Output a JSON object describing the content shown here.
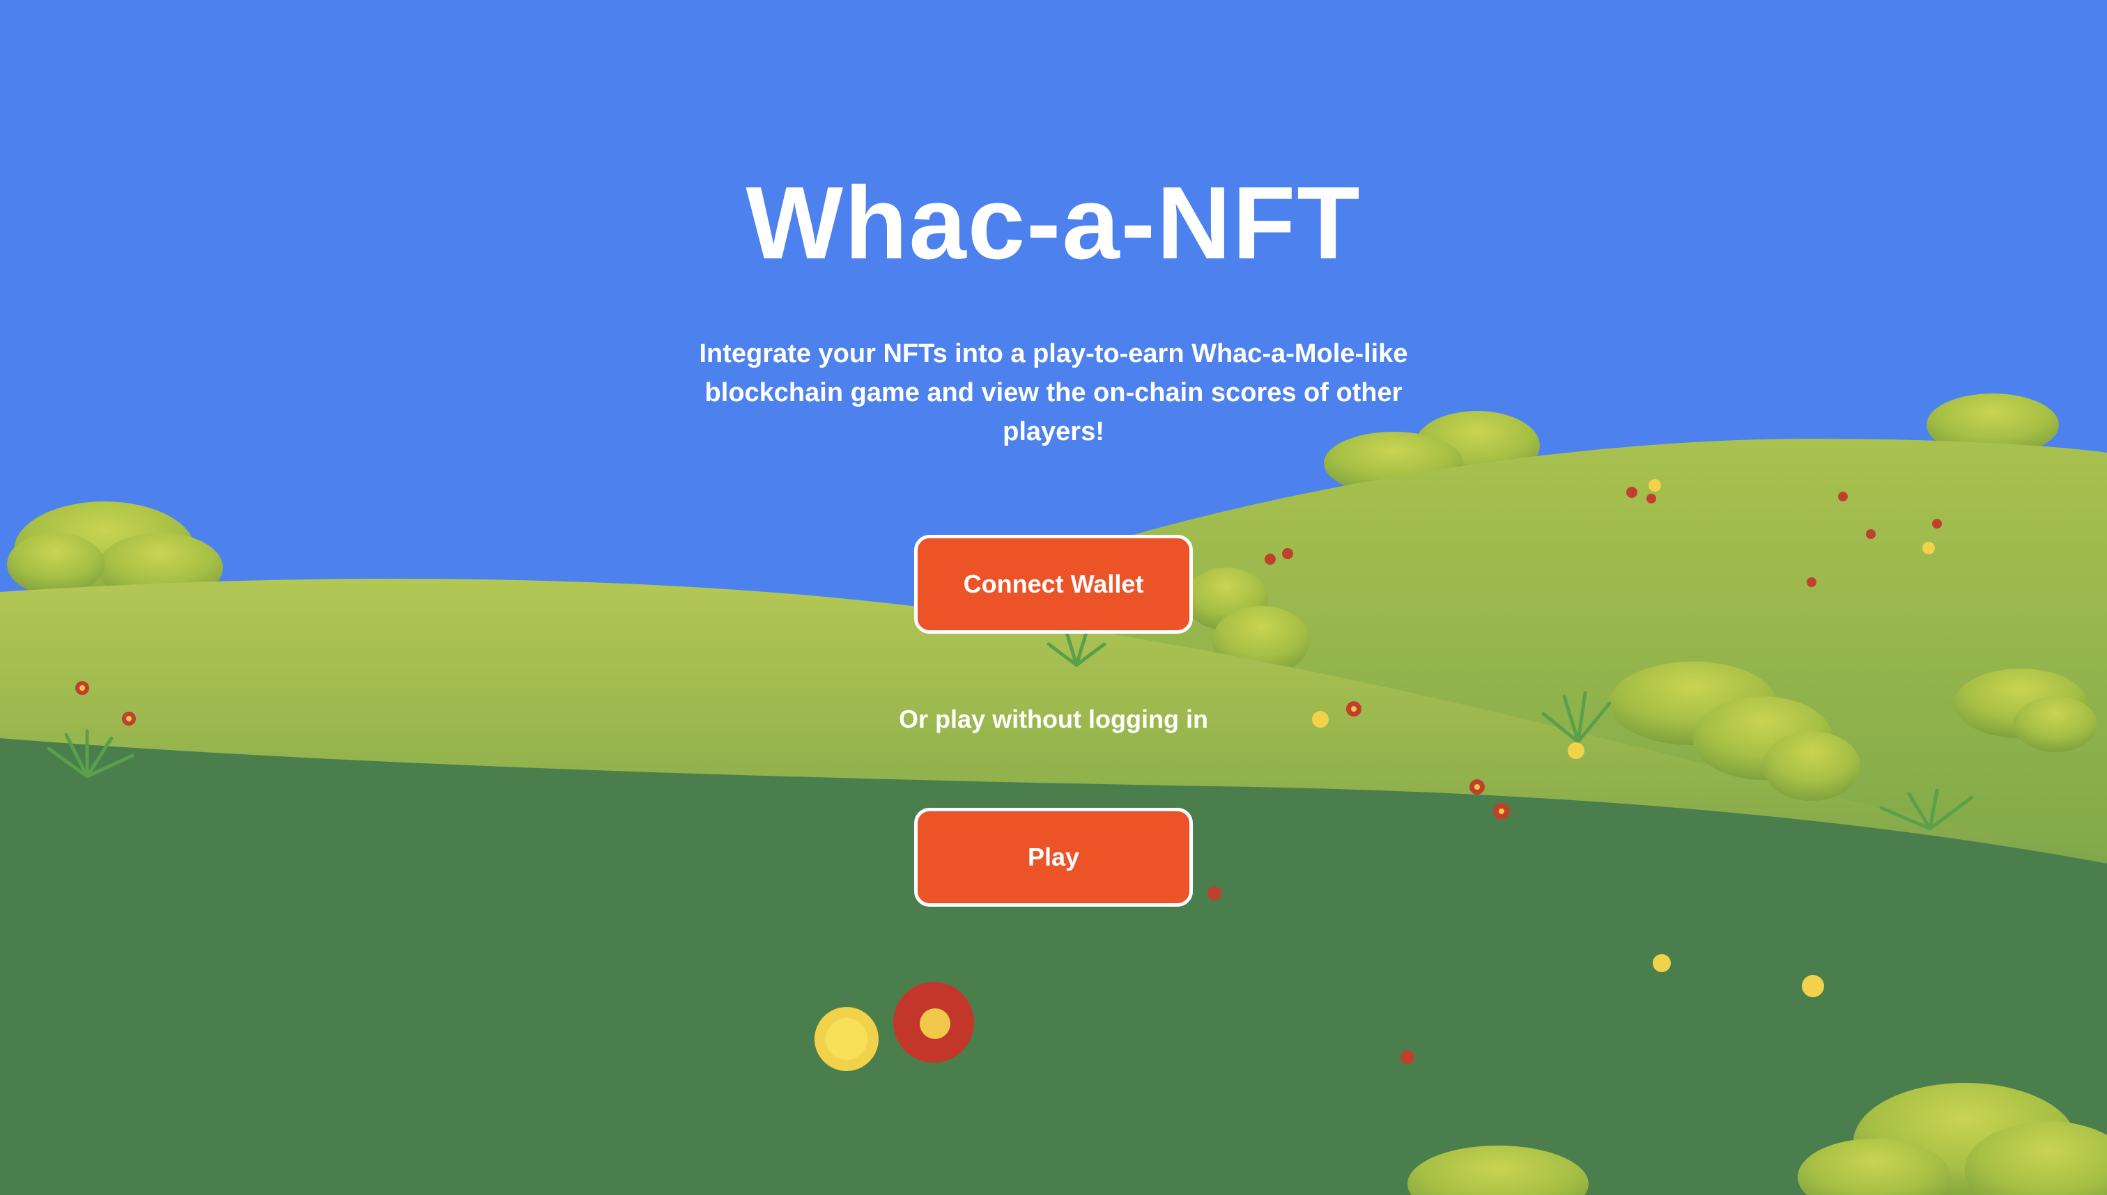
{
  "page": {
    "title": "Whac-a-NFT",
    "description": "Integrate your NFTs into a play-to-earn Whac-a-Mole-like blockchain game and view the on-chain scores of other players!",
    "connect_label": "Connect Wallet",
    "alt_text": "Or play without logging in",
    "play_label": "Play"
  },
  "colors": {
    "sky": "#4c81ee",
    "hill_light": "#a8c150",
    "hill_dark": "#4a7e4d",
    "button": "#ec5428",
    "button_border": "#ffffff",
    "text": "#ffffff"
  }
}
